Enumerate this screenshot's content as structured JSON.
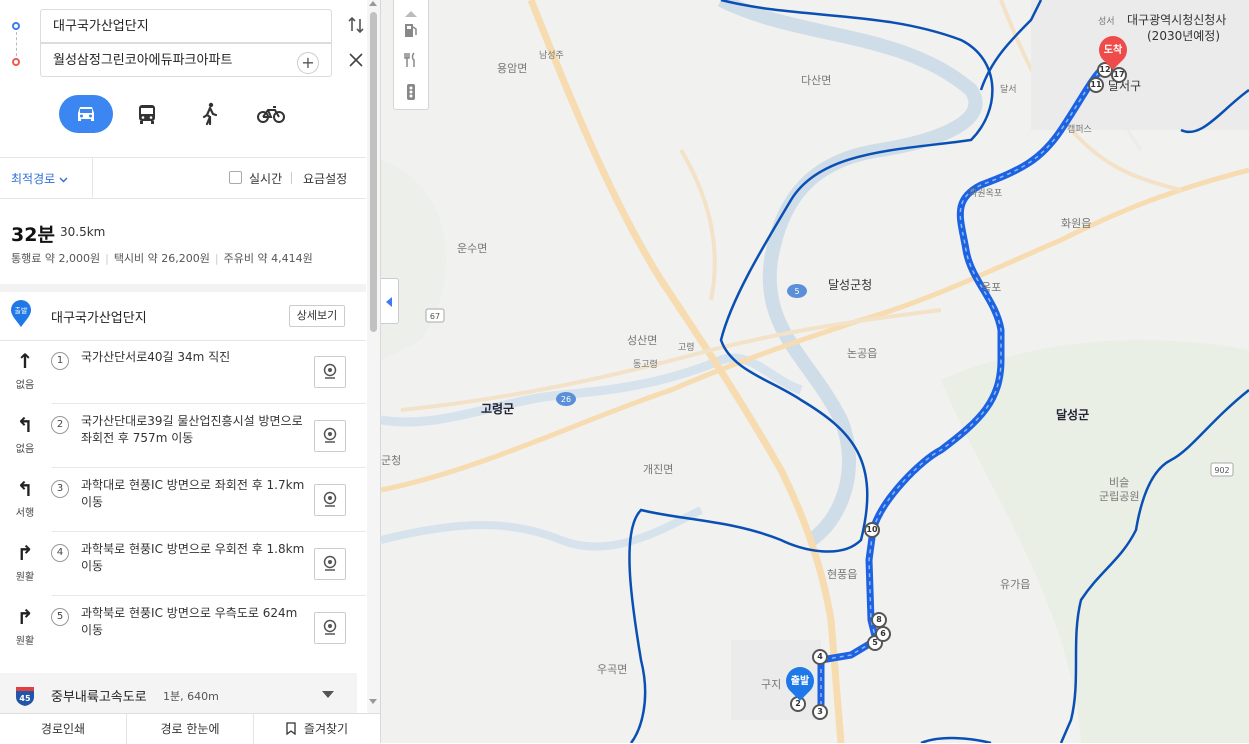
{
  "search": {
    "from": "대구국가산업단지",
    "to": "월성삼정그린코아에듀파크아파트",
    "add_label": "+",
    "swap_icon": "swap-icon",
    "close_icon": "close-icon"
  },
  "modes": [
    "car",
    "bus",
    "walk",
    "bike"
  ],
  "options": {
    "route_type": "최적경로",
    "realtime_label": "실시간",
    "fare_setting": "요금설정"
  },
  "summary": {
    "time": "32분",
    "distance": "30.5km",
    "toll": "통행료 약 2,000원",
    "taxi": "택시비 약 26,200원",
    "fuel": "주유비 약 4,414원"
  },
  "start": {
    "badge": "출발",
    "name": "대구국가산업단지",
    "detail_label": "상세보기"
  },
  "steps": [
    {
      "num": "1",
      "arrow": "↑",
      "road": "없음",
      "text": "국가산단서로40길 34m 직진"
    },
    {
      "num": "2",
      "arrow": "↰",
      "road": "없음",
      "text": "국가산단대로39길 물산업진흥시설 방면으로 좌회전 후 757m 이동"
    },
    {
      "num": "3",
      "arrow": "↰",
      "road": "서행",
      "text": "과학대로 현풍IC 방면으로 좌회전 후 1.7km 이동"
    },
    {
      "num": "4",
      "arrow": "↱",
      "road": "원활",
      "text": "과학북로 현풍IC 방면으로 우회전 후 1.8km 이동"
    },
    {
      "num": "5",
      "arrow": "↱",
      "road": "원활",
      "text": "과학북로 현풍IC 방면으로 우측도로 624m 이동"
    }
  ],
  "highway": {
    "badge": "45",
    "name": "중부내륙고속도로",
    "info": "1분, 640m"
  },
  "bottom": {
    "print": "경로인쇄",
    "overview": "경로 한눈에",
    "favorite": "즐겨찾기"
  },
  "map": {
    "labels": {
      "dasan": "다산면",
      "yongam": "용암면",
      "seongju": "남성주",
      "unsu": "운수면",
      "goryeong_county": "고령군",
      "seongsan": "성산면",
      "goryeong": "고령",
      "donggoryeong": "동고령",
      "gaejin": "개진면",
      "ugok": "우곡면",
      "dalseong_office": "달성군청",
      "nongong": "논공읍",
      "dalseong_county": "달성군",
      "hwawon": "화원읍",
      "hwawon_ok": "화원옥포",
      "okpo": "옥포",
      "hyeonpung": "현풍읍",
      "yuga": "유가읍",
      "biseul": "비슬",
      "park": "군립공원",
      "dalseo": "달서구",
      "city_hall": "대구광역시청신청사",
      "city_hall_year": "(2030년예정)",
      "gunchung": "군청",
      "gucheong": "구지",
      "seongseo": "성서",
      "dalseo2": "달서",
      "campus": "캠퍼스"
    },
    "road_numbers": [
      "67",
      "5",
      "26",
      "902"
    ],
    "start_badge": "출발",
    "end_badge": "도착",
    "waypoints": [
      "2",
      "3",
      "4",
      "5",
      "6",
      "8",
      "10",
      "11",
      "12",
      "17"
    ],
    "route_color": "#1d62e0",
    "boundary_color": "#0a4fb4"
  }
}
